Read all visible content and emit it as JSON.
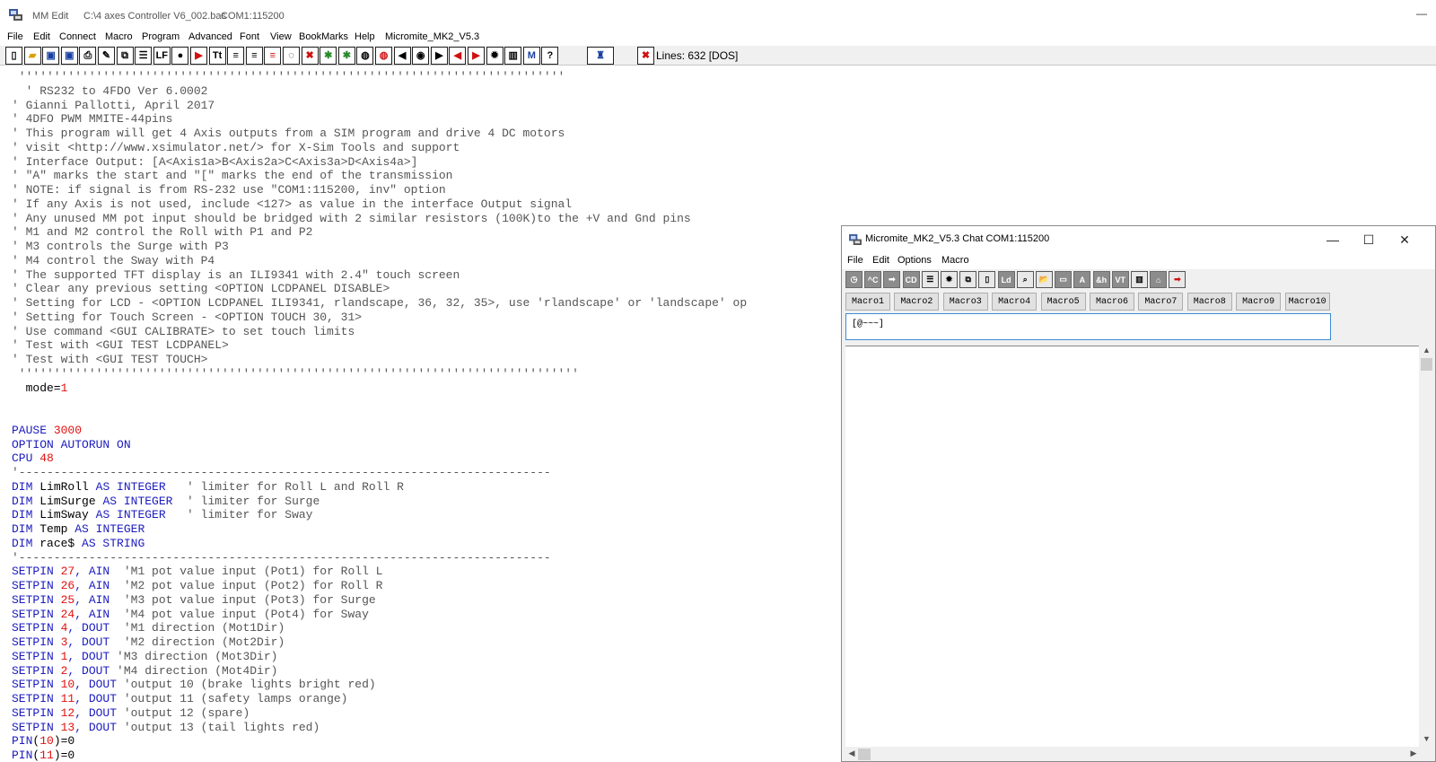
{
  "window": {
    "app_name": "MM Edit",
    "file_path": "C:\\4 axes Controller V6_002.bas",
    "port": "COM1:115200",
    "minimize_glyph": "—"
  },
  "menu": [
    "File",
    "Edit",
    "Connect",
    "Macro",
    "Program",
    "Advanced",
    "Font",
    "View",
    "BookMarks",
    "Help",
    "Micromite_MK2_V5.3"
  ],
  "toolbar": {
    "lines_status": "Lines: 632  [DOS]",
    "buttons": [
      "new-file-icon",
      "open-folder-icon",
      "save-icon",
      "save-as-icon",
      "print-icon",
      "pen-icon",
      "copy-icon",
      "list-icon",
      "lf-icon",
      "dot-icon",
      "run-icon",
      "font-size-icon",
      "align-left-icon",
      "align-right-icon",
      "list-red-icon",
      "speech-icon",
      "stop-icon",
      "bug-icon",
      "bug-green-icon",
      "chat-icon",
      "chat-edit-icon",
      "arrow-left-icon",
      "record-icon",
      "arrow-right-icon",
      "arrow-left-red-icon",
      "arrow-right-red-icon",
      "gear-icon",
      "columns-icon",
      "mm-icon",
      "help-icon",
      "runner-icon",
      "close-red-icon"
    ]
  },
  "editor": {
    "lines": [
      {
        "t": "comment",
        "text": " ''''''''''''''''''''''''''''''''''''''''''''''''''''''''''''''''''''''''''''''"
      },
      {
        "t": "comment",
        "text": "  ' RS232 to 4FDO Ver 6.0002"
      },
      {
        "t": "comment",
        "text": "' Gianni Pallotti, April 2017"
      },
      {
        "t": "comment",
        "text": "' 4DFO PWM MMITE-44pins"
      },
      {
        "t": "comment",
        "text": "' This program will get 4 Axis outputs from a SIM program and drive 4 DC motors"
      },
      {
        "t": "comment",
        "text": "' visit <http://www.xsimulator.net/> for X-Sim Tools and support"
      },
      {
        "t": "comment",
        "text": "' Interface Output: [A<Axis1a>B<Axis2a>C<Axis3a>D<Axis4a>]"
      },
      {
        "t": "comment",
        "text": "' \"A\" marks the start and \"[\" marks the end of the transmission"
      },
      {
        "t": "comment",
        "text": "' NOTE: if signal is from RS-232 use \"COM1:115200, inv\" option"
      },
      {
        "t": "comment",
        "text": "' If any Axis is not used, include <127> as value in the interface Output signal"
      },
      {
        "t": "comment",
        "text": "' Any unused MM pot input should be bridged with 2 similar resistors (100K)to the +V and Gnd pins"
      },
      {
        "t": "comment",
        "text": "' M1 and M2 control the Roll with P1 and P2"
      },
      {
        "t": "comment",
        "text": "' M3 controls the Surge with P3"
      },
      {
        "t": "comment",
        "text": "' M4 control the Sway with P4"
      },
      {
        "t": "comment",
        "text": "' The supported TFT display is an ILI9341 with 2.4\" touch screen"
      },
      {
        "t": "comment",
        "text": "' Clear any previous setting <OPTION LCDPANEL DISABLE>"
      },
      {
        "t": "comment",
        "text": "' Setting for LCD - <OPTION LCDPANEL ILI9341, rlandscape, 36, 32, 35>, use 'rlandscape' or 'landscape' op"
      },
      {
        "t": "comment",
        "text": "' Setting for Touch Screen - <OPTION TOUCH 30, 31>"
      },
      {
        "t": "comment",
        "text": "' Use command <GUI CALIBRATE> to set touch limits"
      },
      {
        "t": "comment",
        "text": "' Test with <GUI TEST LCDPANEL>"
      },
      {
        "t": "comment",
        "text": "' Test with <GUI TEST TOUCH>"
      },
      {
        "t": "comment",
        "text": " ''''''''''''''''''''''''''''''''''''''''''''''''''''''''''''''''''''''''''''''''"
      },
      {
        "t": "mixed",
        "parts": [
          [
            "ident",
            "  mode="
          ],
          [
            "num",
            "1"
          ]
        ]
      },
      {
        "t": "blank",
        "text": ""
      },
      {
        "t": "blank",
        "text": ""
      },
      {
        "t": "mixed",
        "parts": [
          [
            "kw",
            "PAUSE "
          ],
          [
            "num",
            "3000"
          ]
        ]
      },
      {
        "t": "mixed",
        "parts": [
          [
            "kw",
            "OPTION AUTORUN ON"
          ]
        ]
      },
      {
        "t": "mixed",
        "parts": [
          [
            "kw",
            "CPU "
          ],
          [
            "num",
            "48"
          ]
        ]
      },
      {
        "t": "comment",
        "text": "'----------------------------------------------------------------------------"
      },
      {
        "t": "mixed",
        "parts": [
          [
            "kw",
            "DIM "
          ],
          [
            "ident",
            "LimRoll "
          ],
          [
            "kw",
            "AS INTEGER"
          ],
          [
            "comment",
            "   ' limiter for Roll L and Roll R"
          ]
        ]
      },
      {
        "t": "mixed",
        "parts": [
          [
            "kw",
            "DIM "
          ],
          [
            "ident",
            "LimSurge "
          ],
          [
            "kw",
            "AS INTEGER"
          ],
          [
            "comment",
            "  ' limiter for Surge"
          ]
        ]
      },
      {
        "t": "mixed",
        "parts": [
          [
            "kw",
            "DIM "
          ],
          [
            "ident",
            "LimSway "
          ],
          [
            "kw",
            "AS INTEGER"
          ],
          [
            "comment",
            "   ' limiter for Sway"
          ]
        ]
      },
      {
        "t": "mixed",
        "parts": [
          [
            "kw",
            "DIM "
          ],
          [
            "ident",
            "Temp "
          ],
          [
            "kw",
            "AS INTEGER"
          ]
        ]
      },
      {
        "t": "mixed",
        "parts": [
          [
            "kw",
            "DIM "
          ],
          [
            "ident",
            "race$ "
          ],
          [
            "kw",
            "AS STRING"
          ]
        ]
      },
      {
        "t": "comment",
        "text": "'----------------------------------------------------------------------------"
      },
      {
        "t": "mixed",
        "parts": [
          [
            "kw",
            "SETPIN "
          ],
          [
            "num",
            "27"
          ],
          [
            "kw",
            ", AIN"
          ],
          [
            "comment",
            "  'M1 pot value input (Pot1) for Roll L"
          ]
        ]
      },
      {
        "t": "mixed",
        "parts": [
          [
            "kw",
            "SETPIN "
          ],
          [
            "num",
            "26"
          ],
          [
            "kw",
            ", AIN"
          ],
          [
            "comment",
            "  'M2 pot value input (Pot2) for Roll R"
          ]
        ]
      },
      {
        "t": "mixed",
        "parts": [
          [
            "kw",
            "SETPIN "
          ],
          [
            "num",
            "25"
          ],
          [
            "kw",
            ", AIN"
          ],
          [
            "comment",
            "  'M3 pot value input (Pot3) for Surge"
          ]
        ]
      },
      {
        "t": "mixed",
        "parts": [
          [
            "kw",
            "SETPIN "
          ],
          [
            "num",
            "24"
          ],
          [
            "kw",
            ", AIN"
          ],
          [
            "comment",
            "  'M4 pot value input (Pot4) for Sway"
          ]
        ]
      },
      {
        "t": "mixed",
        "parts": [
          [
            "kw",
            "SETPIN "
          ],
          [
            "num",
            "4"
          ],
          [
            "kw",
            ", DOUT"
          ],
          [
            "comment",
            "  'M1 direction (Mot1Dir)"
          ]
        ]
      },
      {
        "t": "mixed",
        "parts": [
          [
            "kw",
            "SETPIN "
          ],
          [
            "num",
            "3"
          ],
          [
            "kw",
            ", DOUT"
          ],
          [
            "comment",
            "  'M2 direction (Mot2Dir)"
          ]
        ]
      },
      {
        "t": "mixed",
        "parts": [
          [
            "kw",
            "SETPIN "
          ],
          [
            "num",
            "1"
          ],
          [
            "kw",
            ", DOUT"
          ],
          [
            "comment",
            " 'M3 direction (Mot3Dir)"
          ]
        ]
      },
      {
        "t": "mixed",
        "parts": [
          [
            "kw",
            "SETPIN "
          ],
          [
            "num",
            "2"
          ],
          [
            "kw",
            ", DOUT"
          ],
          [
            "comment",
            " 'M4 direction (Mot4Dir)"
          ]
        ]
      },
      {
        "t": "mixed",
        "parts": [
          [
            "kw",
            "SETPIN "
          ],
          [
            "num",
            "10"
          ],
          [
            "kw",
            ", DOUT"
          ],
          [
            "comment",
            " 'output 10 (brake lights bright red)"
          ]
        ]
      },
      {
        "t": "mixed",
        "parts": [
          [
            "kw",
            "SETPIN "
          ],
          [
            "num",
            "11"
          ],
          [
            "kw",
            ", DOUT"
          ],
          [
            "comment",
            " 'output 11 (safety lamps orange)"
          ]
        ]
      },
      {
        "t": "mixed",
        "parts": [
          [
            "kw",
            "SETPIN "
          ],
          [
            "num",
            "12"
          ],
          [
            "kw",
            ", DOUT"
          ],
          [
            "comment",
            " 'output 12 (spare)"
          ]
        ]
      },
      {
        "t": "mixed",
        "parts": [
          [
            "kw",
            "SETPIN "
          ],
          [
            "num",
            "13"
          ],
          [
            "kw",
            ", DOUT"
          ],
          [
            "comment",
            " 'output 13 (tail lights red)"
          ]
        ]
      },
      {
        "t": "mixed",
        "parts": [
          [
            "kw",
            "PIN"
          ],
          [
            "ident",
            "("
          ],
          [
            "num",
            "10"
          ],
          [
            "ident",
            ")=0"
          ]
        ]
      },
      {
        "t": "mixed",
        "parts": [
          [
            "kw",
            "PIN"
          ],
          [
            "ident",
            "("
          ],
          [
            "num",
            "11"
          ],
          [
            "ident",
            ")=0"
          ]
        ]
      }
    ]
  },
  "chat": {
    "title": "Micromite_MK2_V5.3 Chat  COM1:115200",
    "minimize": "—",
    "maximize": "☐",
    "close": "✕",
    "menu": [
      "File",
      "Edit",
      "Options",
      "Macro"
    ],
    "toolbar": [
      "◷",
      "^C",
      "➡",
      "CD",
      "☰",
      "✹",
      "⧉",
      "▯",
      "Ld",
      "⌕",
      "📂",
      "▭",
      "A",
      "&h",
      "VT",
      "▥",
      "⌂",
      "➡"
    ],
    "macros": [
      "Macro1",
      "Macro2",
      "Macro3",
      "Macro4",
      "Macro5",
      "Macro6",
      "Macro7",
      "Macro8",
      "Macro9",
      "Macro10"
    ],
    "input_value": "[@~~~]"
  },
  "colors": {
    "keyword": "#1c1cbf",
    "number": "#e01010",
    "comment": "#555555",
    "input_focus": "#3c8bd6"
  }
}
